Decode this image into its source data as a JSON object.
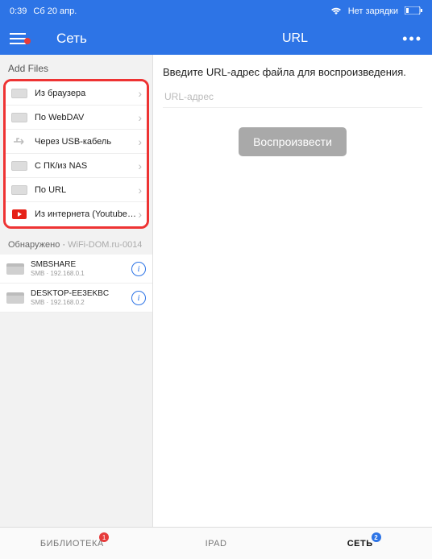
{
  "statusbar": {
    "time": "0:39",
    "date": "Сб 20 апр.",
    "charge": "Нет зарядки"
  },
  "navbar": {
    "left_title": "Сеть",
    "main_title": "URL",
    "more": "•••"
  },
  "sidebar": {
    "add_files_label": "Add Files",
    "items": [
      {
        "label": "Из браузера"
      },
      {
        "label": "По WebDAV"
      },
      {
        "label": "Через USB-кабель"
      },
      {
        "label": "С ПК/из NAS"
      },
      {
        "label": "По URL"
      },
      {
        "label": "Из интернета (Youtube, Vi..."
      }
    ],
    "discovered_label": "Обнаружено",
    "discovered_net": "WiFi-DOM.ru-0014",
    "discovered": [
      {
        "name": "SMBSHARE",
        "sub": "SMB · 192.168.0.1"
      },
      {
        "name": "DESKTOP-EE3EKBC",
        "sub": "SMB · 192.168.0.2"
      }
    ]
  },
  "main": {
    "instruction": "Введите URL-адрес файла для воспроизведения.",
    "placeholder": "URL-адрес",
    "play_label": "Воспроизвести"
  },
  "tabbar": {
    "tabs": [
      {
        "label": "БИБЛИОТЕКА",
        "badge": "1"
      },
      {
        "label": "IPAD"
      },
      {
        "label": "СЕТЬ",
        "badge": "2"
      }
    ]
  }
}
